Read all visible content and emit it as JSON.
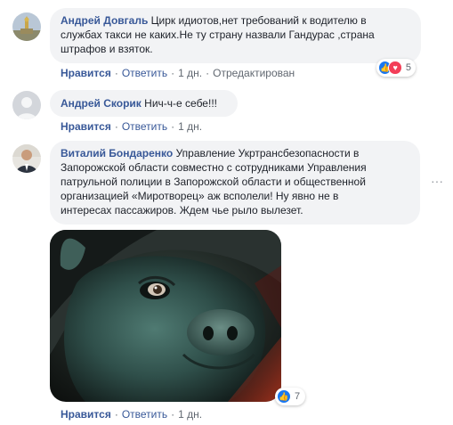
{
  "comments": [
    {
      "author": "Андрей Довгаль",
      "text": "Цирк идиотов,нет требований к водителю в службах такси не каких.Не ту страну назвали Гандурас ,страна штрафов и взяток.",
      "line1": "Цирк идиотов,нет требований к водителю в",
      "line2": "службах такси не каких.Не ту страну назвали Гандурас ,страна",
      "line3": "штрафов и взяток.",
      "like": "Нравится",
      "reply": "Ответить",
      "time": "1 дн.",
      "edited": "Отредактирован",
      "reactions_count": "5"
    },
    {
      "author": "Андрей Скорик",
      "text": "Нич-ч-е себе!!!",
      "like": "Нравится",
      "reply": "Ответить",
      "time": "1 дн."
    },
    {
      "author": "Виталий Бондаренко",
      "line1": "Управление Укртрансбезопасности в",
      "line2": "Запорожской области совместно с сотрудниками Управления",
      "line3": "патрульной полиции в Запорожской области и общественной",
      "line4": "организацией «Миротворец» аж всполели! Ну явно не в",
      "line5": "интересах пассажиров. Ждем чье рыло вылезет.",
      "like": "Нравится",
      "reply": "Ответить",
      "time": "1 дн.",
      "reactions_count": "7"
    }
  ],
  "separator": "·",
  "more_glyph": "···",
  "colors": {
    "link": "#385898",
    "bubble": "#f2f3f5",
    "meta": "#606770",
    "like_blue": "#1877f2",
    "love_red": "#f33e58"
  },
  "icons": [
    "like-reaction-icon",
    "love-reaction-icon",
    "more-options-icon",
    "avatar-icon"
  ]
}
